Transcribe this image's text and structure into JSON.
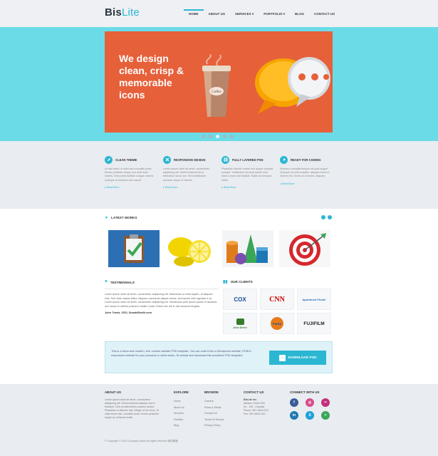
{
  "header": {
    "logo_main": "Bis",
    "logo_accent": "Lite",
    "nav": [
      {
        "label": "HOME",
        "active": true
      },
      {
        "label": "ABOUT US",
        "active": false
      },
      {
        "label": "SERVICES",
        "active": false
      },
      {
        "label": "PORTFOLIO",
        "active": false
      },
      {
        "label": "BLOG",
        "active": false
      },
      {
        "label": "CONTACT US",
        "active": false
      }
    ]
  },
  "hero": {
    "headline": "We design clean, crisp & memorable icons",
    "cup_label": "Coffee",
    "slides": 5,
    "active_slide": 3
  },
  "features": [
    {
      "title": "CLEAN THEME",
      "icon": "pencil-icon",
      "text": "Ut nisi lorem ut dolor sed convallis porta. Donec pharetra neque non ante dolor mauris. Duis porta facilisis congue viverra. Quisque at tincidunt nisi mauris.",
      "more": "Read More"
    },
    {
      "title": "RESPONSIVE DESIGN",
      "icon": "close-icon",
      "text": "Lorem ipsum dolor sit amet, consectetur adipiscing elit. Morbi euismod sit et bibendum lacus non. Sed vestibulum pulvinar neque et mauris.",
      "more": "Read More"
    },
    {
      "title": "FULLY LAYERED PSD",
      "icon": "layers-icon",
      "text": "Phasellus lobortis metus non augue volutpat suscipit. Vestibulum sit amet ipsum sem. Nam a nunc sed facilisis. Nulla non tempus lorem.",
      "more": "Read More"
    },
    {
      "title": "READY FOR CODING",
      "icon": "play-icon",
      "text": "Vivamus convallis tempor est quis augue. Quisque vel velit sodales, aliquam enim et, viverra nisi. Donec ut mi enim, aliquam.",
      "more": "Read More"
    }
  ],
  "works": {
    "title": "LATEST WORKS",
    "items": [
      "clipboard",
      "lemons",
      "shapes",
      "target"
    ]
  },
  "testimonials": {
    "title": "TESTIMONIALS",
    "quote": "Lorem ipsum dolor sit amet, consectetur adipiscing elit. Maecenas ut nulla sapien, at aliquam erat. Sed vitae massa tellus. Aliquam commodo aliquet metus, sed iaculis nibh egestas in ut. Lorem ipsum dolor sit amet, consectetur adipiscing elit. Vestibulum ante ipsum primis in faucibus orci luctus et ultrices posuere cubilia Curae; Etiam nec dui in nisl euismod fringilla.",
    "author": "John Travis, CEO, DonaldSmith.com"
  },
  "clients": {
    "title": "OUR CLIENTS",
    "logos": [
      {
        "name": "COX",
        "color": "#1a4f9c"
      },
      {
        "name": "CNN",
        "color": "#cc0000"
      },
      {
        "name": "Apartment Finder",
        "color": "#2d6fb5"
      },
      {
        "name": "John Deere",
        "color": "#367c2b"
      },
      {
        "name": "Fanta",
        "color": "#e87b1c"
      },
      {
        "name": "FUJIFILM",
        "color": "#222222"
      }
    ]
  },
  "download": {
    "text": "This is a clean and modern, four column website PSD template. You can code it into a Wordpress website, HTML5 responsive website for your personal or client works. So ahead and download this wonderful PSD template!",
    "button": "DOWNLOAD PSD"
  },
  "footer": {
    "about": {
      "title": "ABOUT US",
      "text": "Lorem ipsum dolor sit amet, consectetur adipiscing elit. Morbi euismod dapibus dui ut tincidunt. Sed condimentum posuere auctor. Phasellus ut ultricies nisl. Integer et leo eros. Ut vitae lorem nisl, convallis porta. Donec pharetra neque ac vehicula mollis."
    },
    "explore": {
      "title": "EXPLORE",
      "links": [
        "Home",
        "About Us",
        "Services",
        "Portfolio",
        "Blog"
      ]
    },
    "browse": {
      "title": "BROWSE",
      "links": [
        "Careers",
        "Press & Media",
        "Contact Us",
        "Terms Of Service",
        "Privacy Policy"
      ]
    },
    "contact": {
      "title": "CONTACT US",
      "company": "BisLite Inc.",
      "lines": [
        "Mission Street 263",
        "04 - 125 - Canada",
        "Phone: 987-6543-210",
        "Fax: 987-6543-210"
      ]
    },
    "connect": {
      "title": "CONNECT WITH US",
      "icons": [
        {
          "name": "facebook-icon",
          "glyph": "f",
          "color": "#3b5b98"
        },
        {
          "name": "dribbble-icon",
          "glyph": "◎",
          "color": "#d64d8c"
        },
        {
          "name": "flickr-icon",
          "glyph": "••",
          "color": "#c4307b"
        },
        {
          "name": "linkedin-icon",
          "glyph": "in",
          "color": "#1e78b4"
        },
        {
          "name": "skype-icon",
          "glyph": "S",
          "color": "#1ea0d8"
        },
        {
          "name": "share-icon",
          "glyph": "<",
          "color": "#3aa657"
        }
      ]
    },
    "copyright": "© Copyright © 2013 Company name All rights reserved 网页模板"
  }
}
